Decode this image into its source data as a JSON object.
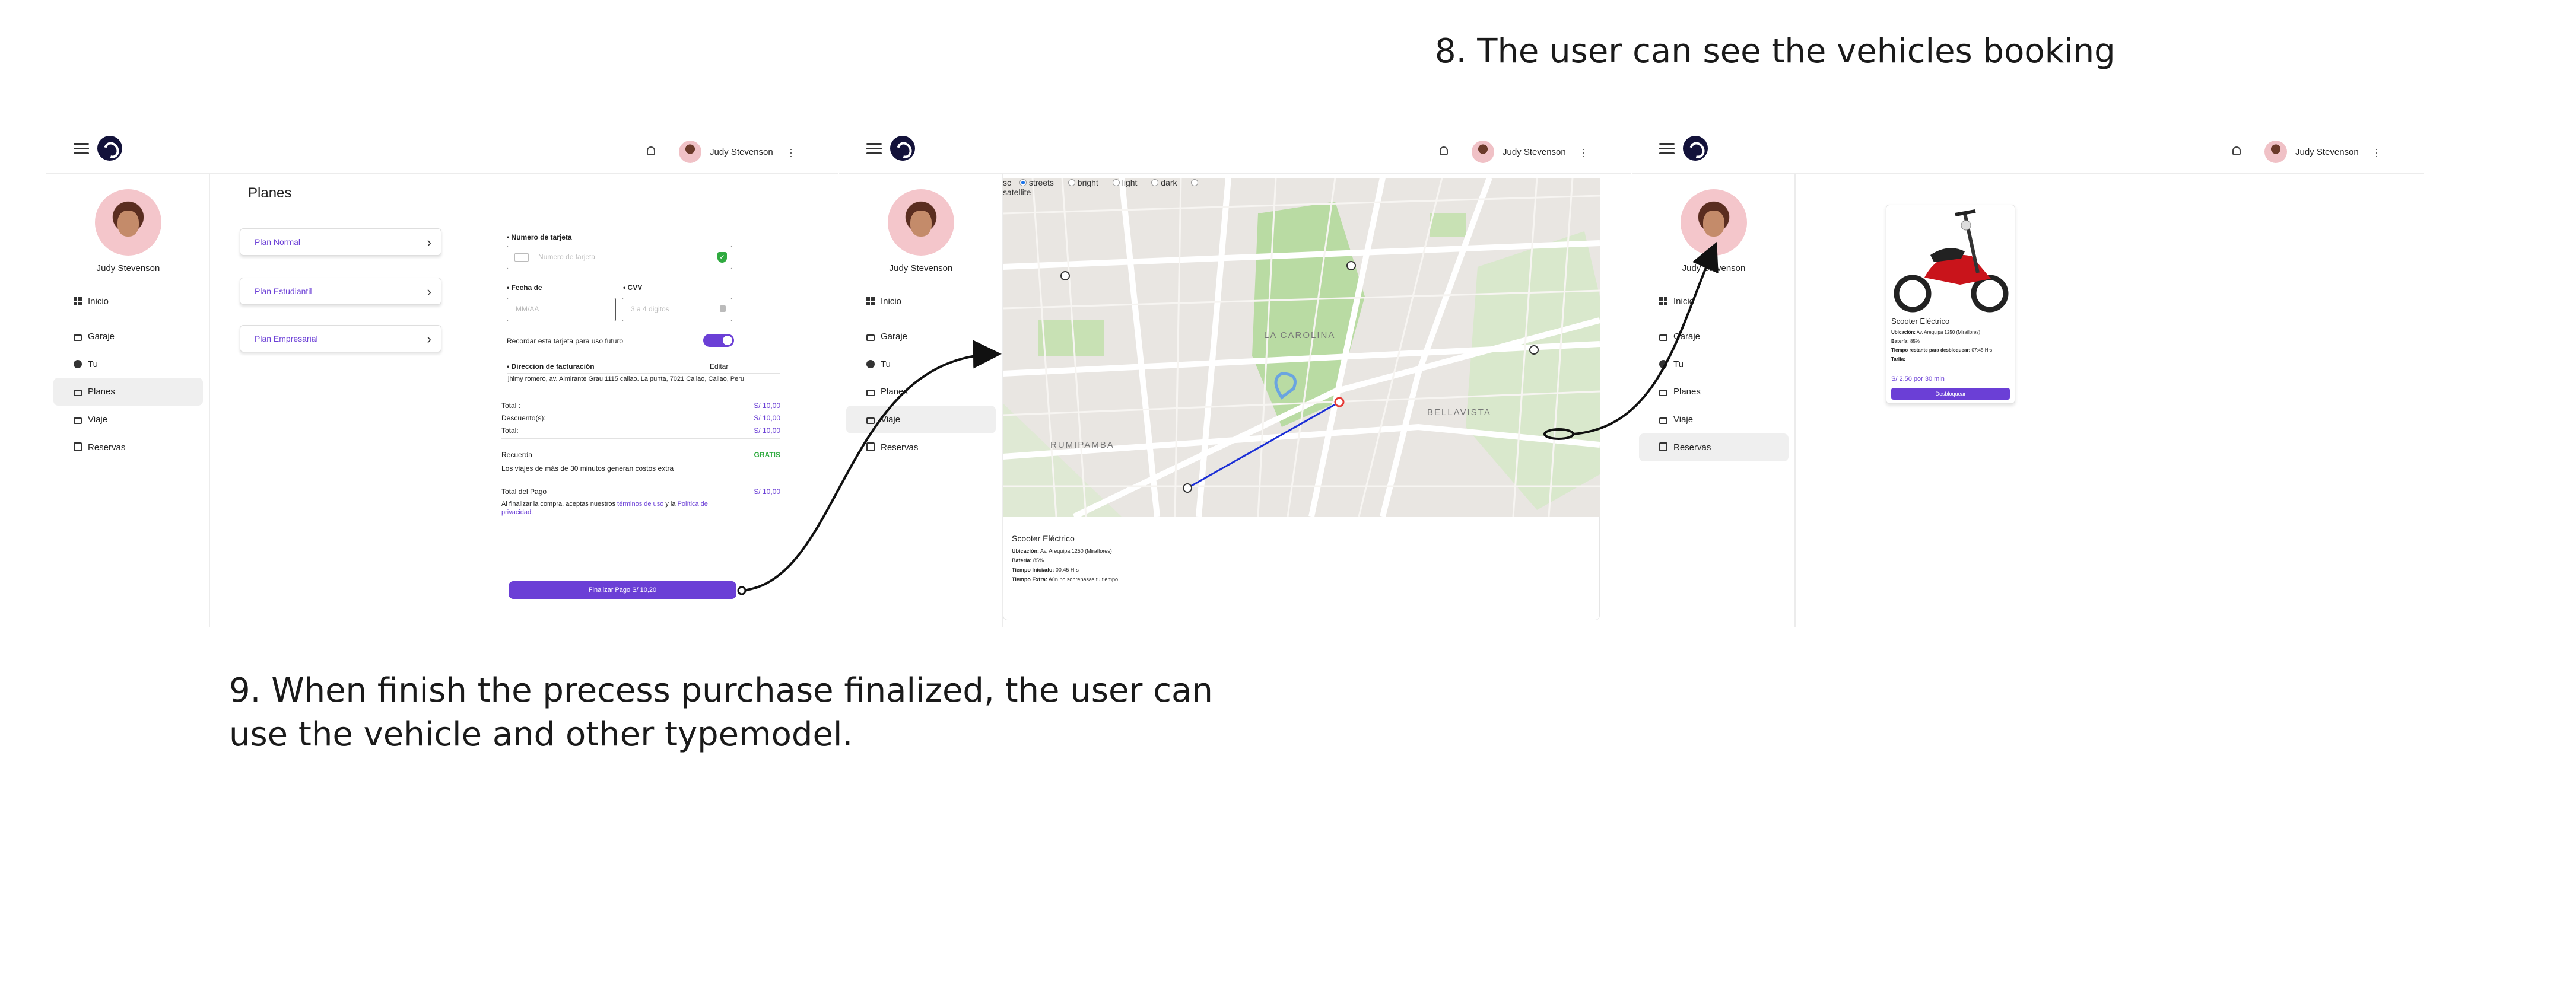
{
  "captions": {
    "step8": "8. The user can see the vehicles booking",
    "step9": " 9. When finish the precess purchase finalized, the user can use the vehicle and other typemodel."
  },
  "user": {
    "name": "Judy Stevenson"
  },
  "sidebar": {
    "items": [
      {
        "label": "Inicio",
        "icon": "grid-icon"
      },
      {
        "label": "Garaje",
        "icon": "lock-icon"
      },
      {
        "label": "Tu",
        "icon": "user-icon"
      },
      {
        "label": "Planes",
        "icon": "lock-icon"
      },
      {
        "label": "Viaje",
        "icon": "lock-icon"
      },
      {
        "label": "Reservas",
        "icon": "clipboard-icon"
      }
    ]
  },
  "screen1": {
    "title": "Planes",
    "plans": [
      "Plan Normal",
      "Plan Estudiantil",
      "Plan Empresarial"
    ],
    "card_number_label": "Numero de tarjeta",
    "card_number_placeholder": "Numero de tarjeta",
    "date_label": "Fecha de",
    "date_placeholder": "MM/AA",
    "cvv_label": "CVV",
    "cvv_placeholder": "3 a 4 digitos",
    "remember_label": "Recordar esta tarjeta para uso futuro",
    "billing_label": "Direccion de facturación",
    "edit_label": "Editar",
    "billing_address": "jhimy romero, av. Almirante Grau 1115 callao. La punta, 7021 Callao, Callao, Peru",
    "summary": [
      {
        "label": "Total :",
        "value": "S/ 10,00"
      },
      {
        "label": "Descuento(s):",
        "value": "S/ 10,00"
      },
      {
        "label": "Total:",
        "value": "S/ 10,00"
      }
    ],
    "reminder_label": "Recuerda",
    "reminder_badge": "GRATIS",
    "reminder_text": "Los viajes de más de 30 minutos generan costos extra",
    "payment_total_label": "Total del Pago",
    "payment_total_value": "S/ 10,00",
    "terms_prefix": "Al finalizar la compra, aceptas nuestros",
    "terms_link": "términos de uso",
    "terms_mid": "y la",
    "privacy_link": "Política de privacidad.",
    "pay_button": "Finalizar Pago S/ 10,20"
  },
  "screen2": {
    "map_styles": [
      "sc",
      "streets",
      "bright",
      "light",
      "dark",
      "satellite"
    ],
    "selected_style": "streets",
    "map_labels": [
      "LA CAROLINA",
      "RUMIPAMBA",
      "BELLAVISTA"
    ],
    "vehicle": {
      "title": "Scooter Eléctrico",
      "lines": [
        {
          "k": "Ubicación:",
          "v": "Av. Arequipa 1250 (Miraflores)"
        },
        {
          "k": "Batería:",
          "v": "85%"
        },
        {
          "k": "Tiempo Iniciado:",
          "v": "00:45 Hrs"
        },
        {
          "k": "Tiempo Extra:",
          "v": "Aún no sobrepasas tu tiempo"
        }
      ]
    }
  },
  "screen3": {
    "card": {
      "title": "Scooter Eléctrico",
      "lines": [
        {
          "k": "Ubicación:",
          "v": "Av. Arequipa 1250 (Miraflores)"
        },
        {
          "k": "Batería:",
          "v": "85%"
        },
        {
          "k": "Tiempo restante para desbloquear:",
          "v": "07:45 Hrs"
        },
        {
          "k": "Tarifa:",
          "v": ""
        }
      ],
      "price": "S/ 2.50 por 30 min",
      "button": "Desbloquear"
    }
  }
}
